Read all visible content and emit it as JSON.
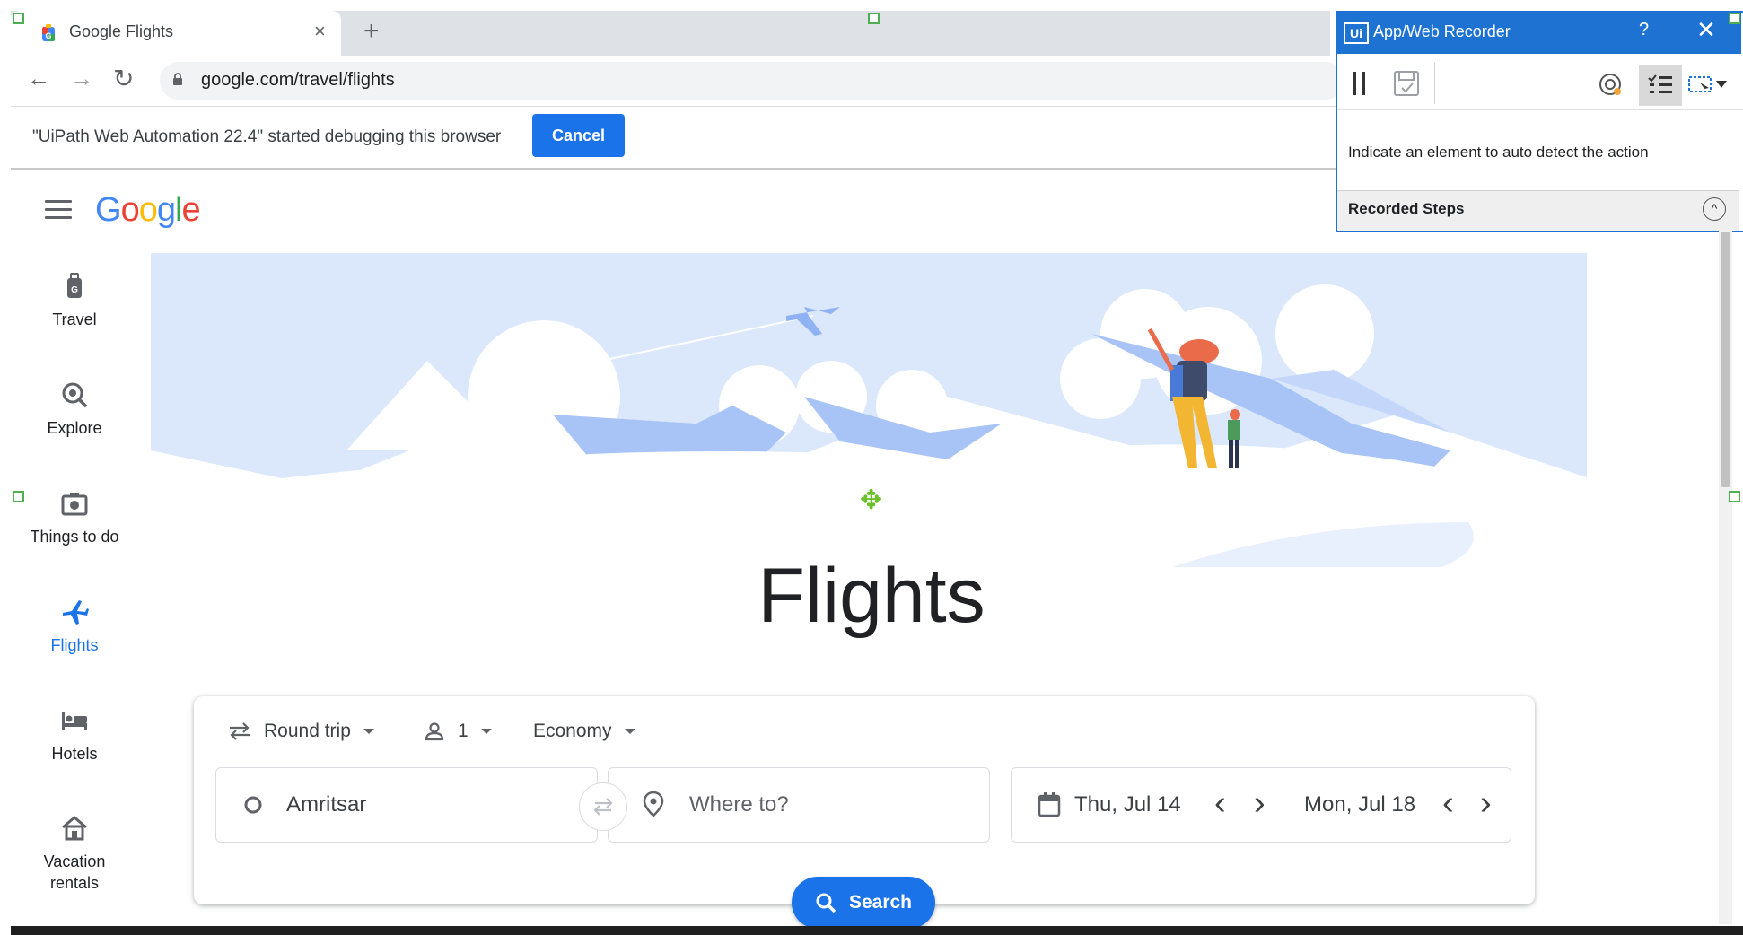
{
  "browser": {
    "tab_title": "Google Flights",
    "tab_close": "×",
    "new_tab": "+",
    "url": "google.com/travel/flights",
    "back": "←",
    "forward": "→",
    "reload": "↻",
    "infobar_text": "\"UiPath Web Automation 22.4\" started debugging this browser",
    "infobar_cancel": "Cancel"
  },
  "header": {
    "logo_letters": [
      "G",
      "o",
      "o",
      "g",
      "l",
      "e"
    ],
    "logo_colors": [
      "#4285f4",
      "#ea4335",
      "#fbbc05",
      "#4285f4",
      "#34a853",
      "#ea4335"
    ]
  },
  "sidebar": {
    "items": [
      {
        "label": "Travel",
        "icon": "luggage-icon",
        "active": false
      },
      {
        "label": "Explore",
        "icon": "explore-icon",
        "active": false
      },
      {
        "label": "Things to do",
        "icon": "camera-icon",
        "active": false
      },
      {
        "label": "Flights",
        "icon": "airplane-icon",
        "active": true
      },
      {
        "label": "Hotels",
        "icon": "bed-icon",
        "active": false
      },
      {
        "label": "Vacation\nrentals",
        "icon": "house-icon",
        "active": false
      }
    ],
    "active_color": "#1a73e8"
  },
  "main": {
    "title": "Flights"
  },
  "search": {
    "trip_type": "Round trip",
    "passengers": "1",
    "cabin_class": "Economy",
    "origin": "Amritsar",
    "destination_placeholder": "Where to?",
    "depart_date": "Thu, Jul 14",
    "return_date": "Mon, Jul 18",
    "prev": "‹",
    "next": "›",
    "search_label": "Search"
  },
  "recorder": {
    "title": "App/Web Recorder",
    "logo": "Ui",
    "help": "?",
    "close": "✕",
    "message": "Indicate an element to auto detect the action",
    "steps_label": "Recorded Steps",
    "collapse": "^"
  },
  "colors": {
    "accent": "#1a73e8",
    "recorder_blue": "#1e73d2",
    "hero_blue": "#a8c4f7"
  }
}
